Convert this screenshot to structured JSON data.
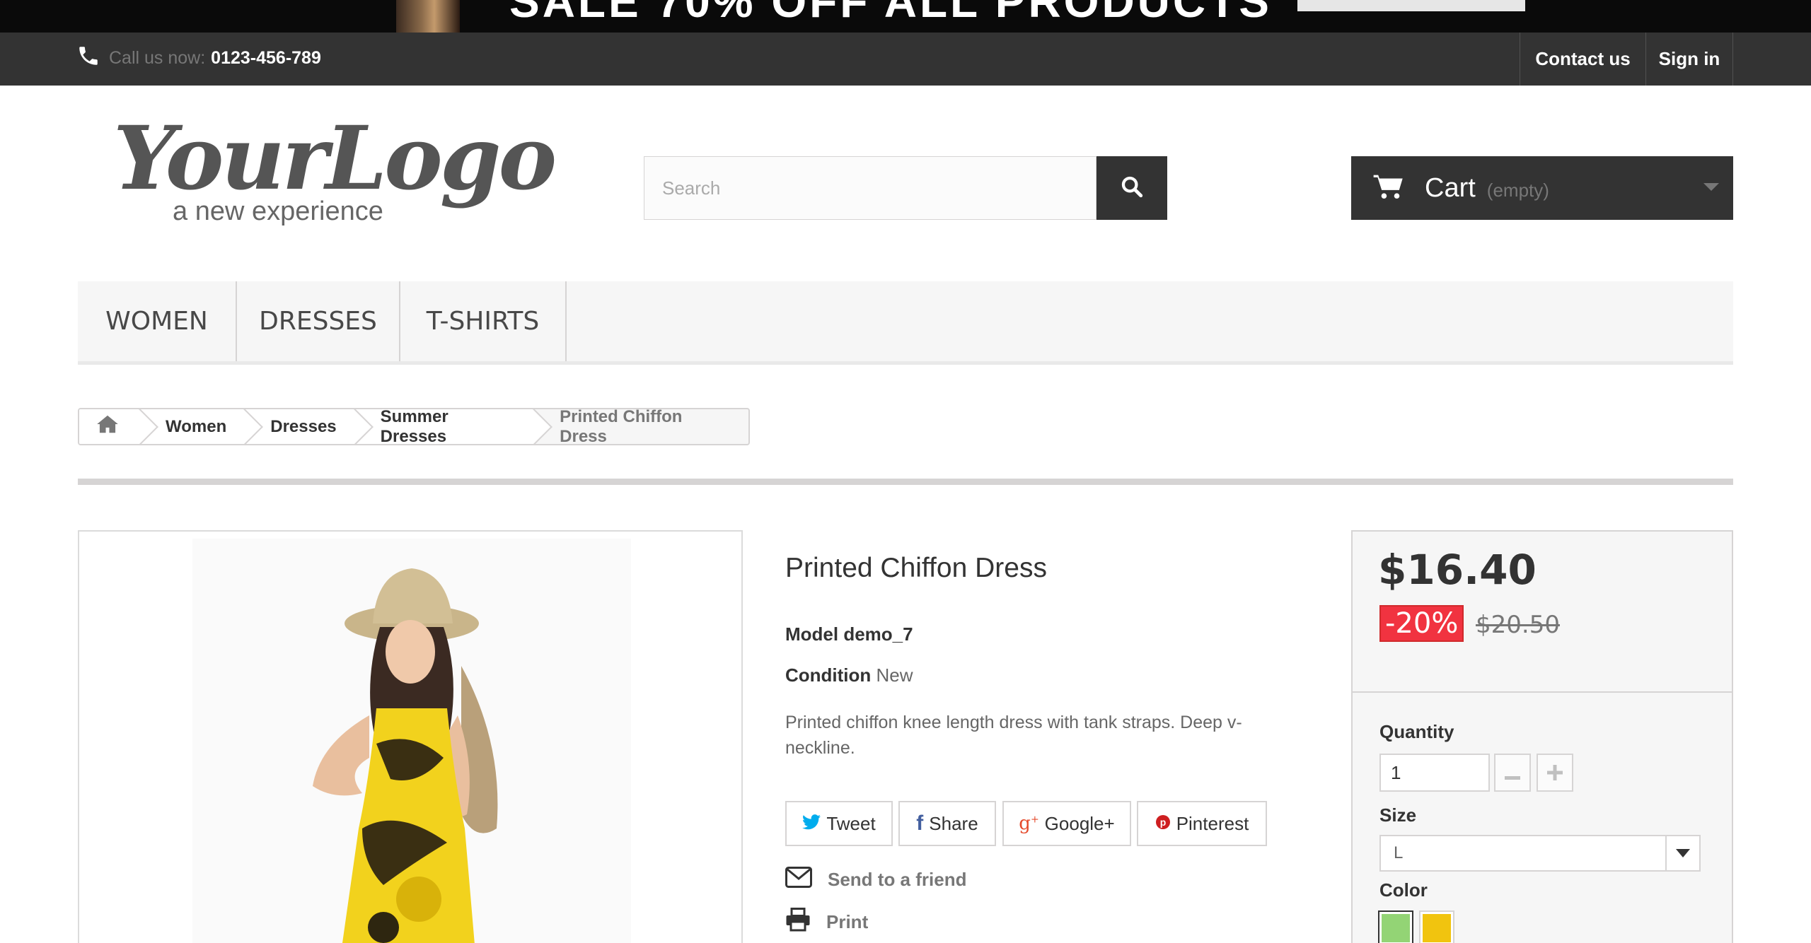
{
  "promo": {
    "text": "SALE 70% OFF ALL PRODUCTS"
  },
  "topbar": {
    "call_label": "Call us now:",
    "phone": "0123-456-789",
    "contact": "Contact us",
    "signin": "Sign in"
  },
  "logo": {
    "main": "YourLogo",
    "tagline": "a new experience"
  },
  "search": {
    "placeholder": "Search"
  },
  "cart": {
    "label": "Cart",
    "status": "(empty)"
  },
  "menu": {
    "items": [
      {
        "label": "WOMEN"
      },
      {
        "label": "DRESSES"
      },
      {
        "label": "T-SHIRTS"
      }
    ]
  },
  "breadcrumb": {
    "items": [
      "Women",
      "Dresses",
      "Summer Dresses",
      "Printed Chiffon Dress"
    ]
  },
  "product": {
    "title": "Printed Chiffon Dress",
    "model_label": "Model",
    "model": "demo_7",
    "condition_label": "Condition",
    "condition": "New",
    "description": "Printed chiffon knee length dress with tank straps. Deep v-neckline.",
    "share": {
      "tweet": "Tweet",
      "share": "Share",
      "google": "Google+",
      "pinterest": "Pinterest"
    },
    "send_to_friend": "Send to a friend",
    "print": "Print"
  },
  "pricing": {
    "price": "$16.40",
    "discount": "-20%",
    "old_price": "$20.50",
    "quantity_label": "Quantity",
    "quantity": "1",
    "size_label": "Size",
    "size": "L",
    "color_label": "Color",
    "colors": [
      "#93d475",
      "#f1c40f"
    ]
  }
}
